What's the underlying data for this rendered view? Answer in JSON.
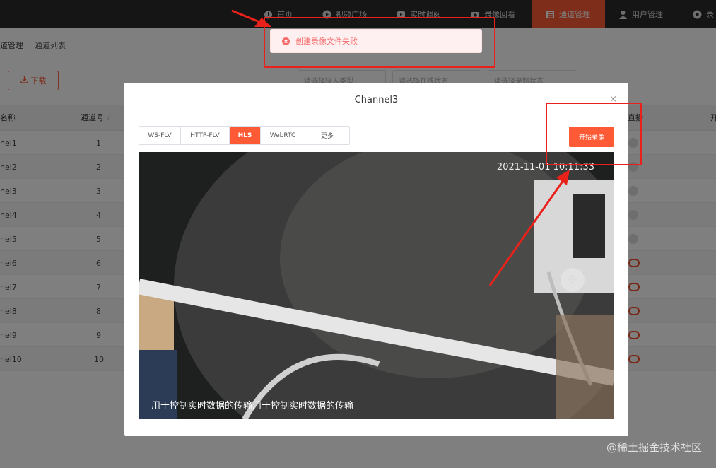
{
  "nav": {
    "items": [
      {
        "label": "首页",
        "icon": "dashboard-icon"
      },
      {
        "label": "视频广场",
        "icon": "play-icon"
      },
      {
        "label": "实时调阅",
        "icon": "video-icon"
      },
      {
        "label": "录像回看",
        "icon": "camera-icon"
      },
      {
        "label": "通道管理",
        "icon": "grid-icon",
        "active": true
      },
      {
        "label": "用户管理",
        "icon": "user-icon"
      },
      {
        "label": "录",
        "icon": "settings-icon"
      }
    ]
  },
  "breadcrumb": {
    "current": "道管理",
    "sub": "通道列表"
  },
  "toolbar": {
    "download_label": "下载",
    "select_placeholders": [
      "请选择接入类型",
      "请选择在线状态",
      "请选择录制状态"
    ]
  },
  "table": {
    "columns": [
      "名称",
      "通道号",
      "直播",
      "开"
    ],
    "rows": [
      {
        "name": "nel1",
        "no": "1"
      },
      {
        "name": "nel2",
        "no": "2"
      },
      {
        "name": "nel3",
        "no": "3"
      },
      {
        "name": "nel4",
        "no": "4"
      },
      {
        "name": "nel5",
        "no": "5"
      },
      {
        "name": "nel6",
        "no": "6"
      },
      {
        "name": "nel7",
        "no": "7"
      },
      {
        "name": "nel8",
        "no": "8"
      },
      {
        "name": "nel9",
        "no": "9"
      },
      {
        "name": "nel10",
        "no": "10"
      }
    ]
  },
  "dialog": {
    "title": "Channel3",
    "close_symbol": "×",
    "tabs": [
      "WS-FLV",
      "HTTP-FLV",
      "HLS",
      "WebRTC",
      "更多"
    ],
    "active_tab": "HLS",
    "record_button": "开始录像",
    "video": {
      "timestamp": "2021-11-01 10:11:33",
      "caption": "用于控制实时数据的传输用于控制实时数据的传输"
    }
  },
  "toast": {
    "message": "创建录像文件失败",
    "type": "error"
  },
  "watermark": "@稀土掘金技术社区",
  "colors": {
    "accent": "#ff5a36",
    "error": "#f56c6c",
    "annotation": "#e8211b"
  }
}
